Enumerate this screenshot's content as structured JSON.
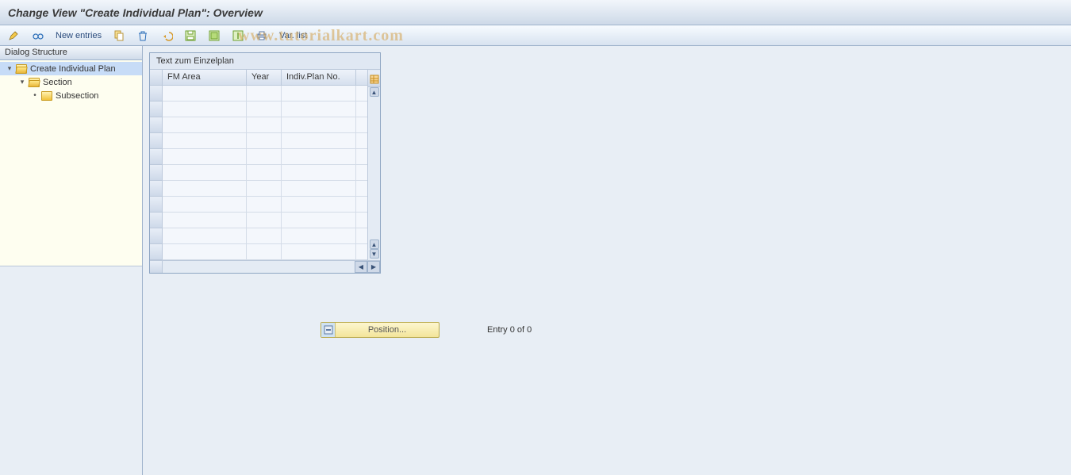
{
  "title": "Change View \"Create Individual Plan\": Overview",
  "watermark": "www.tutorialkart.com",
  "toolbar": {
    "new_entries": "New entries",
    "var_list": "Var. list"
  },
  "tree": {
    "header": "Dialog Structure",
    "nodes": [
      {
        "label": "Create Individual Plan",
        "level": 0,
        "expandable": true,
        "open": true,
        "selected": true
      },
      {
        "label": "Section",
        "level": 1,
        "expandable": true,
        "open": true,
        "selected": false
      },
      {
        "label": "Subsection",
        "level": 2,
        "expandable": false,
        "open": false,
        "selected": false
      }
    ]
  },
  "table": {
    "title": "Text zum Einzelplan",
    "columns": [
      {
        "key": "fm_area",
        "label": "FM Area"
      },
      {
        "key": "year",
        "label": "Year"
      },
      {
        "key": "plan_no",
        "label": "Indiv.Plan No."
      }
    ],
    "rows": [
      {},
      {},
      {},
      {},
      {},
      {},
      {},
      {},
      {},
      {},
      {}
    ]
  },
  "footer": {
    "position": "Position...",
    "entry_count": "Entry 0 of 0"
  }
}
